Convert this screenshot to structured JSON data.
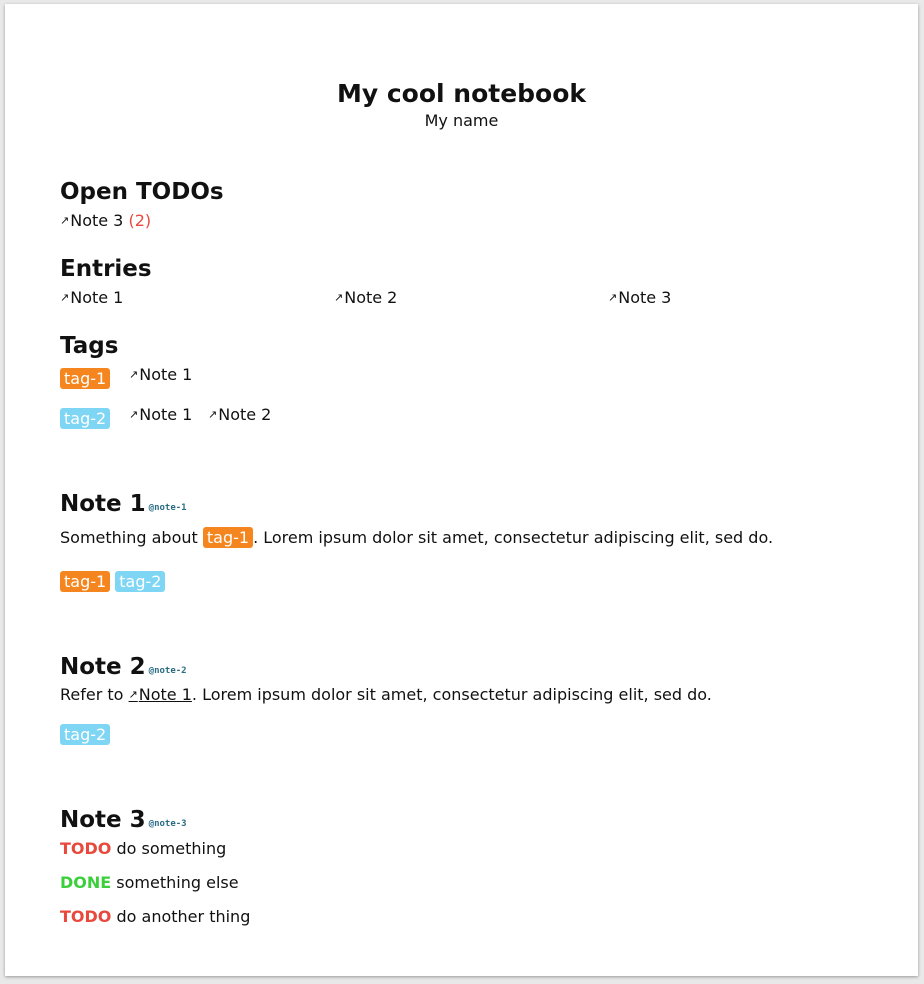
{
  "header": {
    "title": "My cool notebook",
    "author": "My name"
  },
  "open_todos": {
    "heading": "Open TODOs",
    "items": [
      {
        "label": "Note 3",
        "count": "(2)"
      }
    ]
  },
  "entries": {
    "heading": "Entries",
    "items": [
      {
        "label": "Note 1"
      },
      {
        "label": "Note 2"
      },
      {
        "label": "Note 3"
      }
    ]
  },
  "tags": {
    "heading": "Tags",
    "groups": [
      {
        "tag": "tag-1",
        "color": "#f5861f",
        "notes": [
          "Note 1"
        ]
      },
      {
        "tag": "tag-2",
        "color": "#7fd6f4",
        "notes": [
          "Note 1",
          "Note 2"
        ]
      }
    ]
  },
  "notes": [
    {
      "title": "Note 1",
      "id": "@note-1",
      "body_before": "Something about",
      "inline_tag": "tag-1",
      "body_after": ". Lorem ipsum dolor sit amet, consectetur adipiscing elit, sed do.",
      "tags": [
        "tag-1",
        "tag-2"
      ]
    },
    {
      "title": "Note 2",
      "id": "@note-2",
      "body_before": "Refer to",
      "link": "Note 1",
      "body_after": ". Lorem ipsum dolor sit amet, consectetur adipiscing elit, sed do.",
      "tags": [
        "tag-2"
      ]
    },
    {
      "title": "Note 3",
      "id": "@note-3",
      "tasks": [
        {
          "status": "TODO",
          "text": "do something"
        },
        {
          "status": "DONE",
          "text": "something else"
        },
        {
          "status": "TODO",
          "text": "do another thing"
        }
      ]
    }
  ],
  "colors": {
    "todo": "#e8493c",
    "done": "#3ccf3c",
    "tag-1": "#f5861f",
    "tag-2": "#7fd6f4"
  },
  "icons": {
    "link": "north-east-arrow-icon"
  }
}
